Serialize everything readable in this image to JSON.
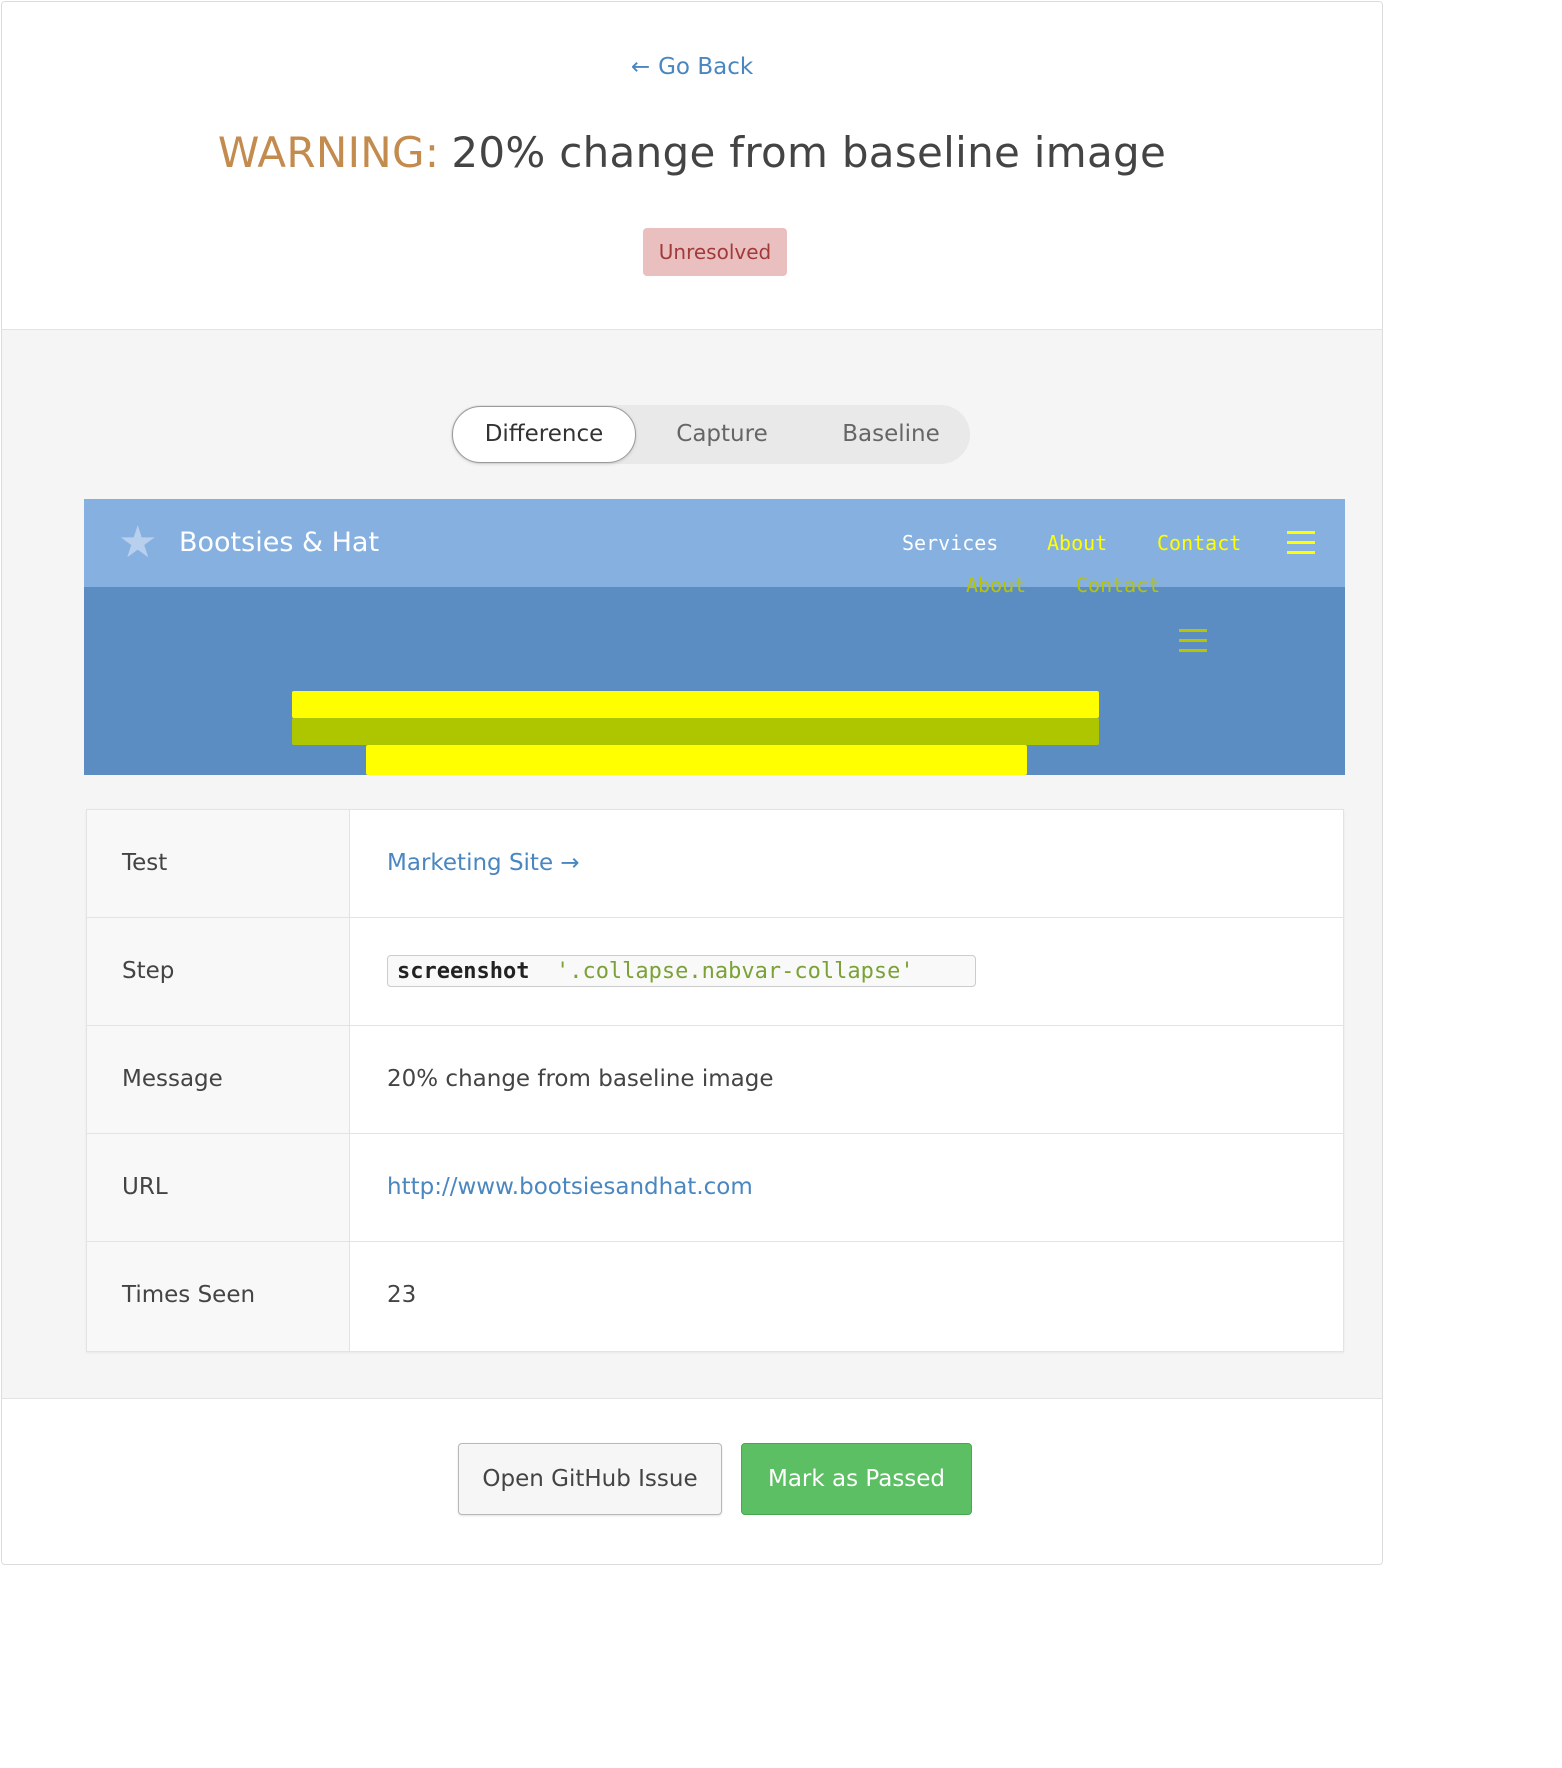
{
  "header": {
    "go_back_arrow": "←",
    "go_back_label": "Go Back",
    "title_prefix": "WARNING:",
    "title_text": "20% change from baseline image",
    "status_badge": "Unresolved"
  },
  "tabs": [
    {
      "label": "Difference",
      "active": true
    },
    {
      "label": "Capture",
      "active": false
    },
    {
      "label": "Baseline",
      "active": false
    }
  ],
  "preview": {
    "brand": "Bootsies & Hat",
    "star_glyph": "★",
    "nav_items": [
      "Services",
      "About",
      "Contact"
    ],
    "nav_items_shifted": [
      "About",
      "Contact"
    ],
    "colors": {
      "nav_bg": "#86b0e0",
      "body_bg": "#5b8dc2",
      "diff_highlight": "#ffff00",
      "diff_shadow": "#aec600"
    }
  },
  "details": [
    {
      "label": "Test",
      "value": "Marketing Site →",
      "type": "link"
    },
    {
      "label": "Step",
      "command": "screenshot",
      "argument": "'.collapse.nabvar-collapse'",
      "type": "code"
    },
    {
      "label": "Message",
      "value": "20% change from baseline image",
      "type": "text"
    },
    {
      "label": "URL",
      "value": "http://www.bootsiesandhat.com",
      "type": "link"
    },
    {
      "label": "Times Seen",
      "value": "23",
      "type": "text"
    }
  ],
  "actions": {
    "github_label": "Open GitHub Issue",
    "pass_label": "Mark as Passed"
  },
  "colors": {
    "warning": "#c38b4e",
    "link": "#4a86c0",
    "badge_bg": "#e9bfc0",
    "badge_text": "#a33a3a",
    "success": "#5cbf63"
  }
}
